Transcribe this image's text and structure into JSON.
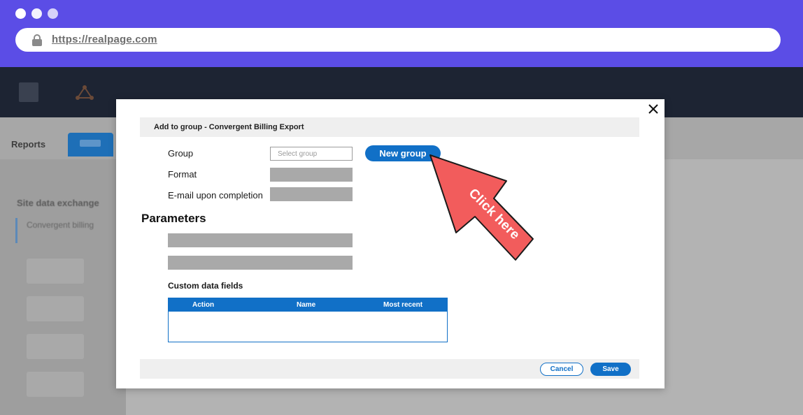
{
  "browser": {
    "url": "https://realpage.com"
  },
  "app_background": {
    "tab_reports": "Reports",
    "nav_title": "Site data exchange",
    "nav_item": "Convergent billing"
  },
  "modal": {
    "title": "Add to group - Convergent Billing Export",
    "fields": {
      "group_label": "Group",
      "group_placeholder": "Select group",
      "format_label": "Format",
      "email_label": "E-mail upon completion"
    },
    "new_group_button": "New group",
    "parameters_heading": "Parameters",
    "custom_fields_label": "Custom data fields",
    "table": {
      "columns": [
        "Action",
        "Name",
        "Most recent"
      ],
      "rows": []
    },
    "footer": {
      "cancel": "Cancel",
      "save": "Save"
    }
  },
  "callout": {
    "text": "Click here",
    "color": "#f25c5c"
  },
  "colors": {
    "browser_bar": "#5b4de6",
    "primary": "#1170c7",
    "app_header": "#1d2433"
  }
}
